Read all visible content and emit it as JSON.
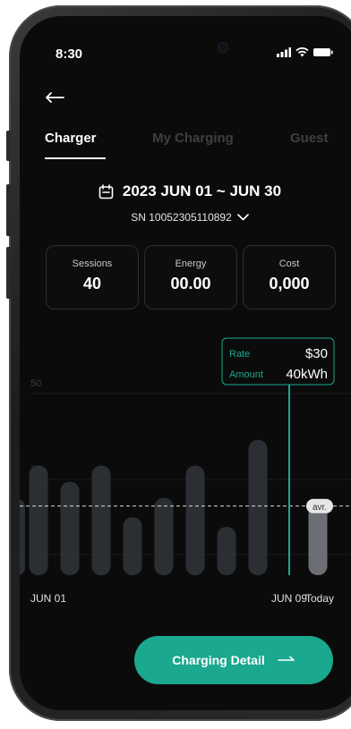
{
  "status_bar": {
    "time": "8:30"
  },
  "tabs": [
    {
      "label": "Charger",
      "active": true
    },
    {
      "label": "My Charging",
      "active": false
    },
    {
      "label": "Guest",
      "active": false
    }
  ],
  "period": {
    "date_range": "2023 JUN 01 ~ JUN 30",
    "serial": "SN 10052305110892"
  },
  "stats": [
    {
      "label": "Sessions",
      "value": "40"
    },
    {
      "label": "Energy",
      "value": "00.00"
    },
    {
      "label": "Cost",
      "value": "0,000"
    }
  ],
  "tooltip": {
    "rate_label": "Rate",
    "rate_value": "$30",
    "amount_label": "Amount",
    "amount_value": "40kWh"
  },
  "chart_data": {
    "type": "bar",
    "y_ticks": [
      "50",
      "25",
      "10"
    ],
    "categories": [
      "JUN 01",
      "",
      "",
      "",
      "",
      "",
      "",
      "",
      "JUN 09",
      "Today"
    ],
    "x_labels_shown": [
      "JUN 01",
      "JUN 09",
      "Today"
    ],
    "values": [
      34,
      29,
      34,
      18,
      24,
      34,
      15,
      42,
      0,
      22
    ],
    "selected_index": 8,
    "average_label": "avr.",
    "average_value": 22,
    "colors": {
      "bar": "#2b2f33",
      "today_bar": "#6b6f73",
      "accent": "#1aa88e"
    }
  },
  "cta": {
    "label": "Charging Detail"
  },
  "colors": {
    "accent": "#1aa88e",
    "background": "#0b0b0b"
  }
}
